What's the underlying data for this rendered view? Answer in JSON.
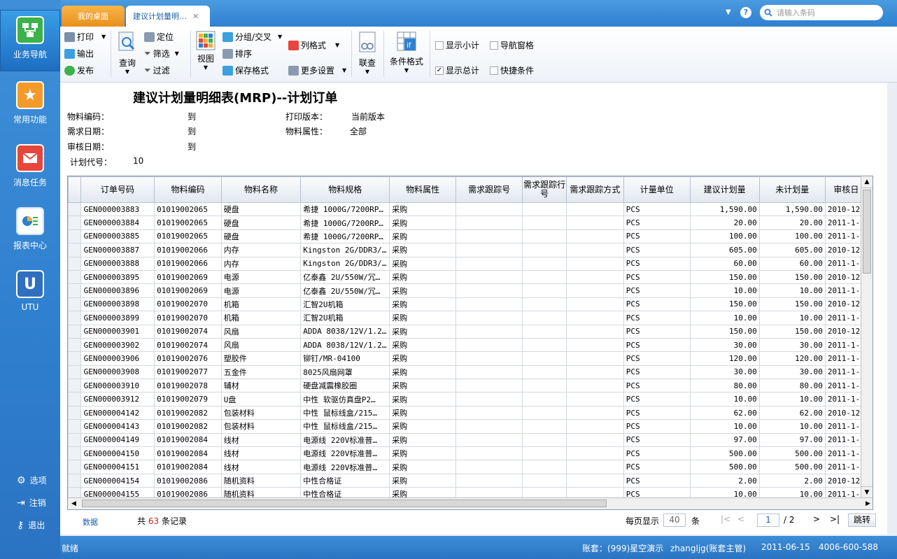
{
  "sidebar": {
    "items": [
      {
        "label": "业务导航",
        "icon": "flowchart-icon"
      },
      {
        "label": "常用功能",
        "icon": "star-icon"
      },
      {
        "label": "消息任务",
        "icon": "mail-icon"
      },
      {
        "label": "报表中心",
        "icon": "report-icon"
      },
      {
        "label": "UTU",
        "icon": "utu-icon"
      }
    ],
    "bottom": [
      {
        "label": "选项",
        "icon": "gear-icon"
      },
      {
        "label": "注销",
        "icon": "logout-icon"
      },
      {
        "label": "退出",
        "icon": "key-icon"
      }
    ]
  },
  "tabs": {
    "home": "我的桌面",
    "active": "建议计划量明…"
  },
  "search": {
    "placeholder": "请输入条码"
  },
  "toolbar": {
    "print": "打印",
    "output": "输出",
    "publish": "发布",
    "query": "查询",
    "locate": "定位",
    "filter": "筛选",
    "filter2": "过滤",
    "view": "视图",
    "group": "分组/交叉",
    "sort": "排序",
    "save_format": "保存格式",
    "col_format": "列格式",
    "more_settings": "更多设置",
    "link_query": "联查",
    "cond_format": "条件格式",
    "show_subtotal": "显示小计",
    "nav_pane": "导航窗格",
    "show_total": "显示总计",
    "quick_cond": "快捷条件"
  },
  "report": {
    "title": "建议计划量明细表(MRP)--计划订单",
    "material_code_label": "物料编码：",
    "to1": "到",
    "demand_date_label": "需求日期：",
    "to2": "到",
    "audit_date_label": "审核日期：",
    "to3": "到",
    "plan_code_label": "计划代号：",
    "plan_code": "10",
    "print_version_label": "打印版本：",
    "print_version": "当前版本",
    "material_attr_label": "物料属性：",
    "material_attr": "全部"
  },
  "grid": {
    "columns": [
      "订单号码",
      "物料编码",
      "物料名称",
      "物料规格",
      "物料属性",
      "需求跟踪号",
      "需求跟踪行号",
      "需求跟踪方式",
      "计量单位",
      "建议计划量",
      "未计划量",
      "审核日"
    ],
    "rows": [
      [
        "GEN000003883",
        "01019002065",
        "硬盘",
        "希捷 1000G/7200RP…",
        "采购",
        "",
        "",
        "",
        "PCS",
        "1,590.00",
        "1,590.00",
        "2010-12-"
      ],
      [
        "GEN000003884",
        "01019002065",
        "硬盘",
        "希捷 1000G/7200RP…",
        "采购",
        "",
        "",
        "",
        "PCS",
        "20.00",
        "20.00",
        "2011-1-6"
      ],
      [
        "GEN000003885",
        "01019002065",
        "硬盘",
        "希捷 1000G/7200RP…",
        "采购",
        "",
        "",
        "",
        "PCS",
        "100.00",
        "100.00",
        "2011-1-1"
      ],
      [
        "GEN000003887",
        "01019002066",
        "内存",
        "Kingston 2G/DDR3/…",
        "采购",
        "",
        "",
        "",
        "PCS",
        "605.00",
        "605.00",
        "2010-12-"
      ],
      [
        "GEN000003888",
        "01019002066",
        "内存",
        "Kingston 2G/DDR3/…",
        "采购",
        "",
        "",
        "",
        "PCS",
        "60.00",
        "60.00",
        "2011-1-6"
      ],
      [
        "GEN000003895",
        "01019002069",
        "电源",
        "亿泰鑫 2U/550W/冗…",
        "采购",
        "",
        "",
        "",
        "PCS",
        "150.00",
        "150.00",
        "2010-12-"
      ],
      [
        "GEN000003896",
        "01019002069",
        "电源",
        "亿泰鑫 2U/550W/冗…",
        "采购",
        "",
        "",
        "",
        "PCS",
        "10.00",
        "10.00",
        "2011-1-6"
      ],
      [
        "GEN000003898",
        "01019002070",
        "机箱",
        "汇智2U机箱",
        "采购",
        "",
        "",
        "",
        "PCS",
        "150.00",
        "150.00",
        "2010-12-"
      ],
      [
        "GEN000003899",
        "01019002070",
        "机箱",
        "汇智2U机箱",
        "采购",
        "",
        "",
        "",
        "PCS",
        "10.00",
        "10.00",
        "2011-1-6"
      ],
      [
        "GEN000003901",
        "01019002074",
        "风扇",
        "ADDA 8038/12V/1.2…",
        "采购",
        "",
        "",
        "",
        "PCS",
        "150.00",
        "150.00",
        "2010-12-"
      ],
      [
        "GEN000003902",
        "01019002074",
        "风扇",
        "ADDA 8038/12V/1.2…",
        "采购",
        "",
        "",
        "",
        "PCS",
        "30.00",
        "30.00",
        "2011-1-6"
      ],
      [
        "GEN000003906",
        "01019002076",
        "塑胶件",
        "铆钉/MR-04100",
        "采购",
        "",
        "",
        "",
        "PCS",
        "120.00",
        "120.00",
        "2011-1-6"
      ],
      [
        "GEN000003908",
        "01019002077",
        "五金件",
        "8025风扇网罩",
        "采购",
        "",
        "",
        "",
        "PCS",
        "30.00",
        "30.00",
        "2011-1-6"
      ],
      [
        "GEN000003910",
        "01019002078",
        "辅材",
        "硬盘减震橡胶圈",
        "采购",
        "",
        "",
        "",
        "PCS",
        "80.00",
        "80.00",
        "2011-1-6"
      ],
      [
        "GEN000003912",
        "01019002079",
        "U盘",
        "中性 软驱仿真盘P2…",
        "采购",
        "",
        "",
        "",
        "PCS",
        "10.00",
        "10.00",
        "2011-1-6"
      ],
      [
        "GEN000004142",
        "01019002082",
        "包装材料",
        "中性 鼠标线盒/215…",
        "采购",
        "",
        "",
        "",
        "PCS",
        "62.00",
        "62.00",
        "2010-12-"
      ],
      [
        "GEN000004143",
        "01019002082",
        "包装材料",
        "中性 鼠标线盒/215…",
        "采购",
        "",
        "",
        "",
        "PCS",
        "10.00",
        "10.00",
        "2011-1-6"
      ],
      [
        "GEN000004149",
        "01019002084",
        "线材",
        "电源线 220V标准普…",
        "采购",
        "",
        "",
        "",
        "PCS",
        "97.00",
        "97.00",
        "2011-1-1"
      ],
      [
        "GEN000004150",
        "01019002084",
        "线材",
        "电源线 220V标准普…",
        "采购",
        "",
        "",
        "",
        "PCS",
        "500.00",
        "500.00",
        "2011-1-1"
      ],
      [
        "GEN000004151",
        "01019002084",
        "线材",
        "电源线 220V标准普…",
        "采购",
        "",
        "",
        "",
        "PCS",
        "500.00",
        "500.00",
        "2011-1-1"
      ],
      [
        "GEN000004154",
        "01019002086",
        "随机资料",
        "中性合格证",
        "采购",
        "",
        "",
        "",
        "PCS",
        "2.00",
        "2.00",
        "2010-12-"
      ],
      [
        "GEN000004155",
        "01019002086",
        "随机资料",
        "中性合格证",
        "采购",
        "",
        "",
        "",
        "PCS",
        "10.00",
        "10.00",
        "2011-1-6"
      ]
    ]
  },
  "footer": {
    "data_label": "数据",
    "total_prefix": "共",
    "total_count": "63",
    "total_suffix": "条记录",
    "per_page_label": "每页显示",
    "per_page": "40",
    "per_page_unit": "条",
    "page": "1",
    "page_total": "/ 2",
    "jump": "跳转"
  },
  "status": {
    "ready": "就绪",
    "account": "账套：(999)星空演示",
    "user": "zhangljg(账套主管)",
    "date": "2011-06-15",
    "phone": "4006-600-588"
  },
  "colors": {
    "accent": "#2f80d0",
    "tab_home": "#f0a030",
    "count_red": "#d02020"
  }
}
